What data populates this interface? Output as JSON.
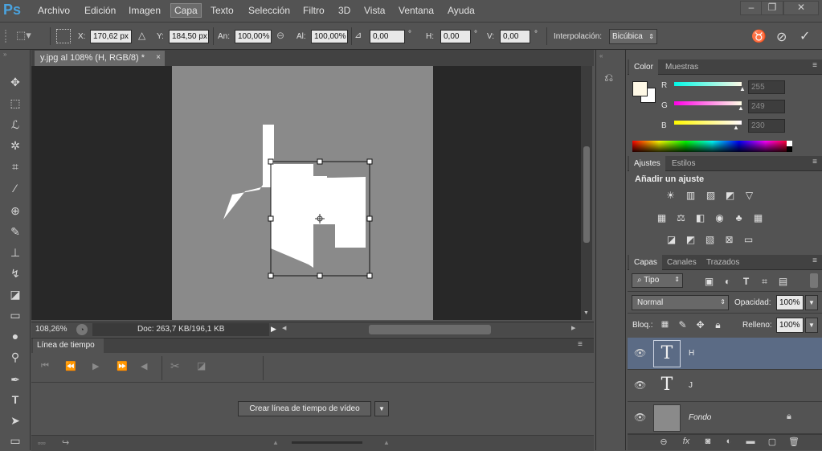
{
  "app": {
    "logo": "Ps"
  },
  "menu": [
    {
      "label": "Archivo"
    },
    {
      "label": "Edición"
    },
    {
      "label": "Imagen"
    },
    {
      "label": "Capa"
    },
    {
      "label": "Texto"
    },
    {
      "label": "Selección"
    },
    {
      "label": "Filtro"
    },
    {
      "label": "3D"
    },
    {
      "label": "Vista"
    },
    {
      "label": "Ventana"
    },
    {
      "label": "Ayuda"
    }
  ],
  "options": {
    "x_label": "X:",
    "x_value": "170,62 px",
    "y_label": "Y:",
    "y_value": "184,50 px",
    "an_label": "An:",
    "an_value": "100,00%",
    "al_label": "Al:",
    "al_value": "100,00%",
    "angle_value": "0,00",
    "angle_unit": "°",
    "h_label": "H:",
    "h_value": "0,00",
    "h_unit": "°",
    "v_label": "V:",
    "v_value": "0,00",
    "v_unit": "°",
    "interp_label": "Interpolación:",
    "interp_value": "Bicúbica"
  },
  "document": {
    "tab_title": "y.jpg al 108% (H, RGB/8) *"
  },
  "status": {
    "zoom": "108,26%",
    "doc_info": "Doc: 263,7 KB/196,1 KB"
  },
  "timeline": {
    "title": "Línea de tiempo",
    "create_button": "Crear línea de tiempo de vídeo"
  },
  "color_panel": {
    "tabs": [
      "Color",
      "Muestras"
    ],
    "r_label": "R",
    "r_value": "255",
    "g_label": "G",
    "g_value": "249",
    "b_label": "B",
    "b_value": "230",
    "foreground": "#fff9e6"
  },
  "adjust_panel": {
    "tabs": [
      "Ajustes",
      "Estilos"
    ],
    "heading": "Añadir un ajuste"
  },
  "layers_panel": {
    "tabs": [
      "Capas",
      "Canales",
      "Trazados"
    ],
    "filter_label": "Tipo",
    "blend_mode": "Normal",
    "opacity_label": "Opacidad:",
    "opacity_value": "100%",
    "lock_label": "Bloq.:",
    "fill_label": "Relleno:",
    "fill_value": "100%",
    "layers": [
      {
        "name": "H",
        "type": "text",
        "selected": true
      },
      {
        "name": "J",
        "type": "text",
        "selected": false
      },
      {
        "name": "Fondo",
        "type": "image",
        "selected": false
      }
    ]
  }
}
